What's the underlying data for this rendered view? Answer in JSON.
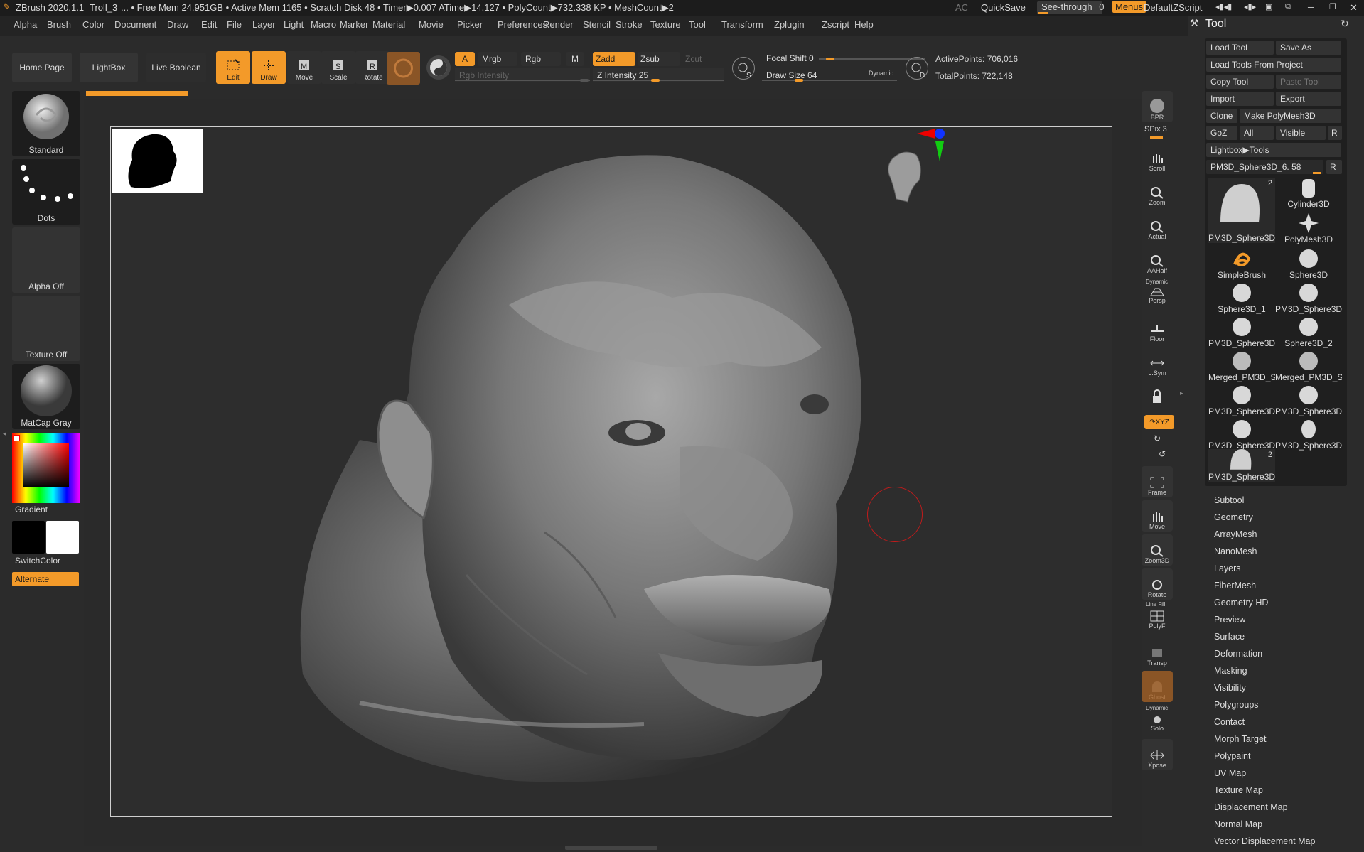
{
  "titlebar": {
    "app": "ZBrush 2020.1.1",
    "doc": "Troll_3",
    "stats": "... • Free Mem 24.951GB • Active Mem 1165 • Scratch Disk 48 •  Timer▶0.007 ATime▶14.127 • PolyCount▶732.338 KP • MeshCount▶2",
    "ac": "AC",
    "quicksave": "QuickSave",
    "see_through_label": "See-through",
    "see_through_value": "0",
    "menus": "Menus",
    "script": "DefaultZScript"
  },
  "menubar": [
    "Alpha",
    "Brush",
    "Color",
    "Document",
    "Draw",
    "Edit",
    "File",
    "Layer",
    "Light",
    "Macro",
    "Marker",
    "Material",
    "Movie",
    "Picker",
    "Preferences",
    "Render",
    "Stencil",
    "Stroke",
    "Texture",
    "Tool",
    "Transform",
    "Zplugin",
    "Zscript",
    "Help"
  ],
  "toolbar": {
    "home": "Home Page",
    "lightbox": "LightBox",
    "live_boolean": "Live Boolean",
    "edit": "Edit",
    "draw": "Draw",
    "move": "Move",
    "scale": "Scale",
    "rotate": "Rotate",
    "a": "A",
    "mrgb": "Mrgb",
    "rgb": "Rgb",
    "m": "M",
    "rgb_intensity": "Rgb Intensity",
    "zadd": "Zadd",
    "zsub": "Zsub",
    "zcut": "Zcut",
    "z_intensity_label": "Z Intensity",
    "z_intensity": "25",
    "z_intensity_level": 0.25,
    "focal_shift_label": "Focal Shift",
    "focal_shift": "0",
    "draw_size_label": "Draw Size",
    "draw_size": "64",
    "dynamic": "Dynamic",
    "s": "S",
    "d": "D",
    "active_points": "ActivePoints: 706,016",
    "total_points": "TotalPoints: 722,148"
  },
  "left_tray": {
    "brush": "Standard",
    "stroke": "Dots",
    "alpha": "Alpha Off",
    "texture": "Texture Off",
    "material": "MatCap Gray",
    "gradient": "Gradient",
    "switch_color": "SwitchColor",
    "alternate": "Alternate"
  },
  "right_shelf": {
    "bpr": "BPR",
    "spix": "SPix 3",
    "scroll": "Scroll",
    "zoom": "Zoom",
    "actual": "Actual",
    "aahalf": "AAHalf",
    "persp_top": "Dynamic",
    "persp": "Persp",
    "floor": "Floor",
    "lsym": "L.Sym",
    "xyz": "↷XYZ",
    "frame": "Frame",
    "move": "Move",
    "zoom3d": "Zoom3D",
    "rotate": "Rotate",
    "polyf_top": "Line Fill",
    "polyf": "PolyF",
    "transp": "Transp",
    "ghost": "Ghost",
    "solo_top": "Dynamic",
    "solo": "Solo",
    "xpose": "Xpose"
  },
  "tool_panel": {
    "title": "Tool",
    "load_tool": "Load Tool",
    "save_as": "Save As",
    "load_from_project": "Load Tools From Project",
    "copy_tool": "Copy Tool",
    "paste_tool": "Paste Tool",
    "import": "Import",
    "export": "Export",
    "clone": "Clone",
    "make_polymesh": "Make PolyMesh3D",
    "goz": "GoZ",
    "all": "All",
    "visible": "Visible",
    "r": "R",
    "lightbox_tools": "Lightbox▶Tools",
    "current_tool": "PM3D_Sphere3D_6. 58",
    "tools": [
      {
        "name": "PM3D_Sphere3D",
        "badge": "2"
      },
      {
        "name": "Cylinder3D",
        "badge": ""
      },
      {
        "name": "PolyMesh3D",
        "badge": ""
      },
      {
        "name": "SimpleBrush",
        "badge": ""
      },
      {
        "name": "Sphere3D",
        "badge": ""
      },
      {
        "name": "Sphere3D_1",
        "badge": ""
      },
      {
        "name": "PM3D_Sphere3D",
        "badge": ""
      },
      {
        "name": "PM3D_Sphere3D",
        "badge": ""
      },
      {
        "name": "Sphere3D_2",
        "badge": ""
      },
      {
        "name": "Merged_PM3D_S",
        "badge": ""
      },
      {
        "name": "Merged_PM3D_S",
        "badge": ""
      },
      {
        "name": "PM3D_Sphere3D",
        "badge": ""
      },
      {
        "name": "PM3D_Sphere3D",
        "badge": ""
      },
      {
        "name": "PM3D_Sphere3D",
        "badge": ""
      },
      {
        "name": "PM3D_Sphere3D",
        "badge": ""
      },
      {
        "name": "PM3D_Sphere3D",
        "badge": "2"
      }
    ],
    "subpalettes": [
      "Subtool",
      "Geometry",
      "ArrayMesh",
      "NanoMesh",
      "Layers",
      "FiberMesh",
      "Geometry HD",
      "Preview",
      "Surface",
      "Deformation",
      "Masking",
      "Visibility",
      "Polygroups",
      "Contact",
      "Morph Target",
      "Polypaint",
      "UV Map",
      "Texture Map",
      "Displacement Map",
      "Normal Map",
      "Vector Displacement Map"
    ]
  },
  "colors": {
    "accent": "#f39a29",
    "bg": "#2b2b2b",
    "canvas": "#2d2d2d",
    "panel": "#333333"
  }
}
